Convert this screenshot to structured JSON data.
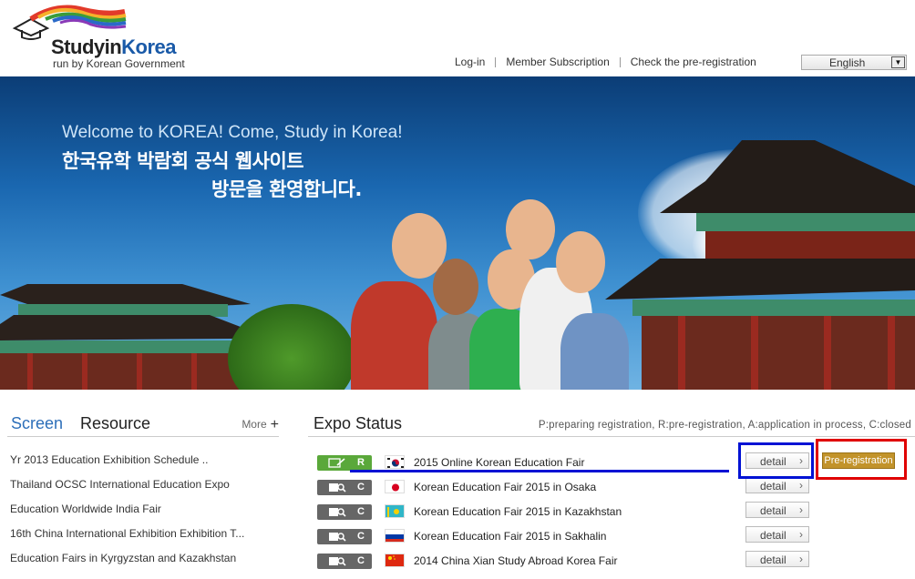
{
  "header": {
    "logo_study": "Studyin",
    "logo_korea": "Korea",
    "logo_tagline": "run by Korean Government",
    "nav": [
      "Log-in",
      "Member Subscription",
      "Check the pre-registration"
    ],
    "language": "English"
  },
  "hero": {
    "welcome": "Welcome to KOREA! Come, Study in Korea!",
    "ko_line1": "한국유학 박람회 공식 웹사이트",
    "ko_line2": "방문을 환영합니다."
  },
  "resources": {
    "tab_screen": "Screen",
    "tab_resource": "Resource",
    "more": "More",
    "items": [
      "Yr 2013 Education Exhibition Schedule ..",
      "Thailand OCSC International Education Expo",
      "Education Worldwide India Fair",
      "16th China International Exhibition Exhibition T...",
      "Education Fairs in Kyrgyzstan and Kazakhstan"
    ]
  },
  "expo": {
    "title": "Expo Status",
    "legend": "P:preparing registration, R:pre-registration, A:application in process, C:closed",
    "detail_label": "detail",
    "prereg_label": "Pre-registration",
    "rows": [
      {
        "status": "R",
        "flag": "korea",
        "name": "2015 Online Korean Education Fair"
      },
      {
        "status": "C",
        "flag": "japan",
        "name": "Korean Education Fair 2015 in Osaka"
      },
      {
        "status": "C",
        "flag": "kazakhstan",
        "name": "Korean Education Fair 2015 in Kazakhstan"
      },
      {
        "status": "C",
        "flag": "russia",
        "name": "Korean Education Fair 2015 in Sakhalin"
      },
      {
        "status": "C",
        "flag": "china",
        "name": "2014 China Xian Study Abroad Korea Fair"
      }
    ]
  },
  "colors": {
    "accent_blue": "#2d6fb9",
    "status_r": "#5aa83a",
    "status_c": "#666666",
    "prereg": "#c2932a",
    "annotation_blue": "#0012d4",
    "annotation_red": "#e00000"
  }
}
